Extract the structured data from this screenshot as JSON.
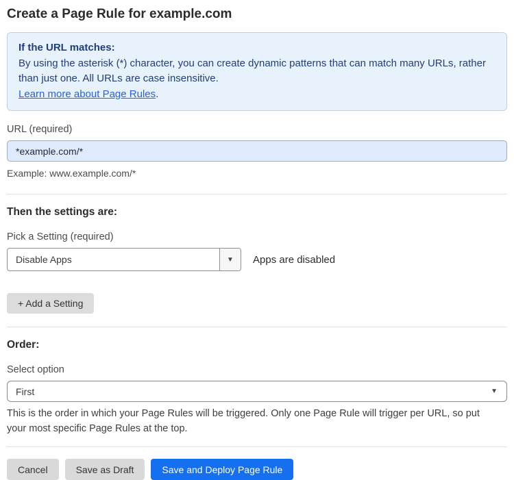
{
  "page": {
    "title": "Create a Page Rule for example.com"
  },
  "info_box": {
    "heading": "If the URL matches:",
    "body": "By using the asterisk (*) character, you can create dynamic patterns that can match many URLs, rather than just one. All URLs are case insensitive.",
    "link_label": "Learn more about Page Rules",
    "link_suffix": "."
  },
  "url_field": {
    "label": "URL (required)",
    "value": "*example.com/*",
    "helper": "Example: www.example.com/*"
  },
  "settings_section": {
    "heading": "Then the settings are:",
    "setting_label": "Pick a Setting (required)",
    "setting_value": "Disable Apps",
    "setting_status": "Apps are disabled",
    "add_setting_label": "+ Add a Setting"
  },
  "order_section": {
    "heading": "Order:",
    "select_label": "Select option",
    "select_value": "First",
    "helper": "This is the order in which your Page Rules will be triggered. Only one Page Rule will trigger per URL, so put your most specific Page Rules at the top."
  },
  "footer": {
    "cancel_label": "Cancel",
    "save_draft_label": "Save as Draft",
    "save_deploy_label": "Save and Deploy Page Rule"
  },
  "icons": {
    "dropdown_arrow": "▼"
  },
  "colors": {
    "info_bg": "#e8f2fc",
    "info_border": "#b9d3ee",
    "info_text": "#1f3d7a",
    "link": "#2862d8",
    "input_bg": "#dfeafd",
    "input_border": "#96aecd",
    "primary_button": "#1570ef",
    "gray_button": "#d9d9d9"
  }
}
